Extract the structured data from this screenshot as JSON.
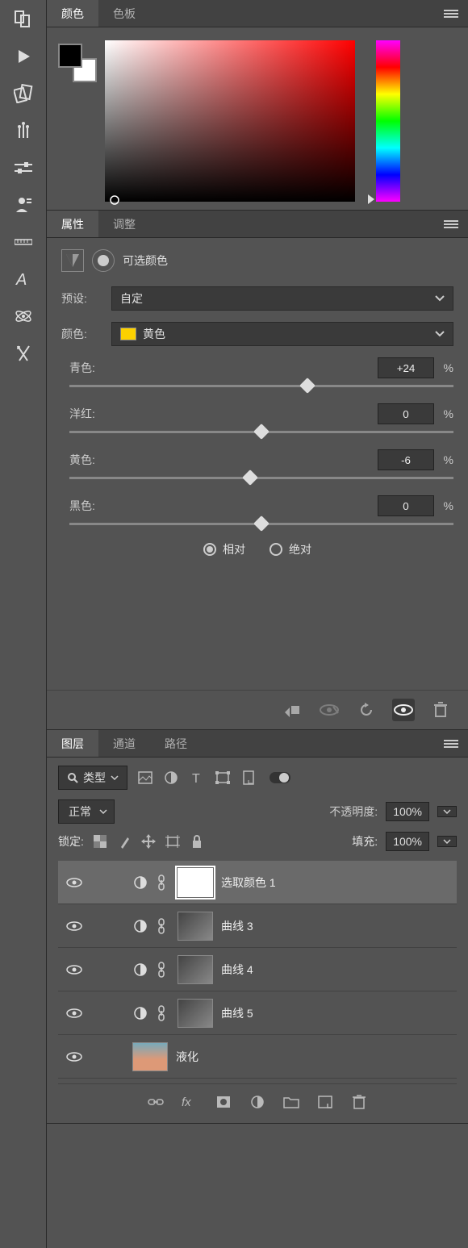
{
  "color_panel": {
    "tabs": [
      "颜色",
      "色板"
    ],
    "active_tab": 0
  },
  "properties_panel": {
    "tabs": [
      "属性",
      "调整"
    ],
    "active_tab": 0,
    "title": "可选颜色",
    "preset_label": "预设:",
    "preset_value": "自定",
    "color_label": "颜色:",
    "color_value": "黄色",
    "sliders": [
      {
        "label": "青色:",
        "value": "+24",
        "unit": "%",
        "pos": 62
      },
      {
        "label": "洋红:",
        "value": "0",
        "unit": "%",
        "pos": 50
      },
      {
        "label": "黄色:",
        "value": "-6",
        "unit": "%",
        "pos": 47
      },
      {
        "label": "黑色:",
        "value": "0",
        "unit": "%",
        "pos": 50
      }
    ],
    "radio": {
      "relative": "相对",
      "absolute": "绝对",
      "checked": "relative"
    }
  },
  "layers_panel": {
    "tabs": [
      "图层",
      "通道",
      "路径"
    ],
    "active_tab": 0,
    "filter_label": "类型",
    "blend_mode": "正常",
    "opacity_label": "不透明度:",
    "opacity_value": "100%",
    "lock_label": "锁定:",
    "fill_label": "填充:",
    "fill_value": "100%",
    "layers": [
      {
        "name": "选取颜色 1",
        "selected": true,
        "adj": true,
        "thumb": "white"
      },
      {
        "name": "曲线 3",
        "selected": false,
        "adj": true,
        "thumb": "img"
      },
      {
        "name": "曲线 4",
        "selected": false,
        "adj": true,
        "thumb": "img"
      },
      {
        "name": "曲线 5",
        "selected": false,
        "adj": true,
        "thumb": "img"
      },
      {
        "name": "液化",
        "selected": false,
        "adj": false,
        "thumb": "photo"
      }
    ]
  }
}
